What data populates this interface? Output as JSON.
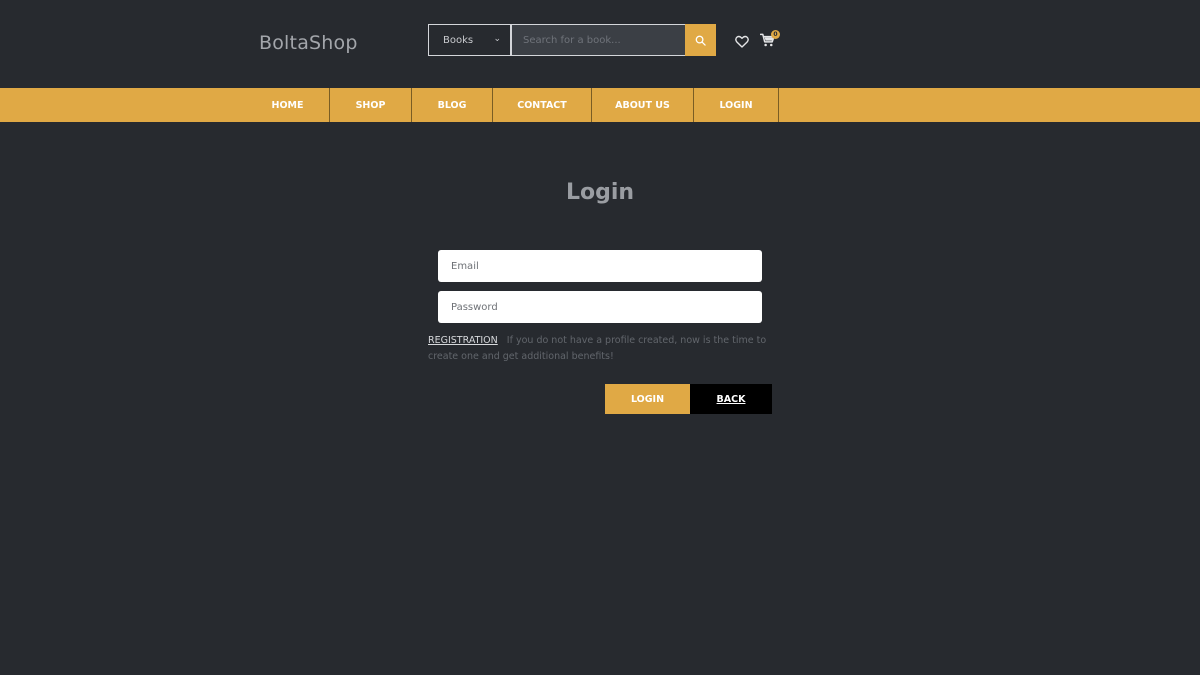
{
  "header": {
    "logo": "BoltaShop",
    "search": {
      "category": "Books",
      "placeholder": "Search for a book..."
    },
    "icons": {
      "chevron": "chevron-down-icon",
      "search": "search-icon",
      "wishlist": "heart-icon",
      "cart": "cart-icon"
    },
    "cart_count": "0"
  },
  "nav": {
    "items": [
      {
        "label": "HOME"
      },
      {
        "label": "SHOP"
      },
      {
        "label": "BLOG"
      },
      {
        "label": "CONTACT"
      },
      {
        "label": "ABOUT US"
      },
      {
        "label": "LOGIN"
      }
    ]
  },
  "main": {
    "title": "Login",
    "email_placeholder": "Email",
    "password_placeholder": "Password",
    "registration_link": "REGISTRATION",
    "registration_text": "If you do not have a profile created, now is the time to create one and get additional benefits!",
    "login_button": "LOGIN",
    "back_button": "BACK"
  },
  "colors": {
    "background": "#272a2f",
    "accent": "#e0a945"
  }
}
